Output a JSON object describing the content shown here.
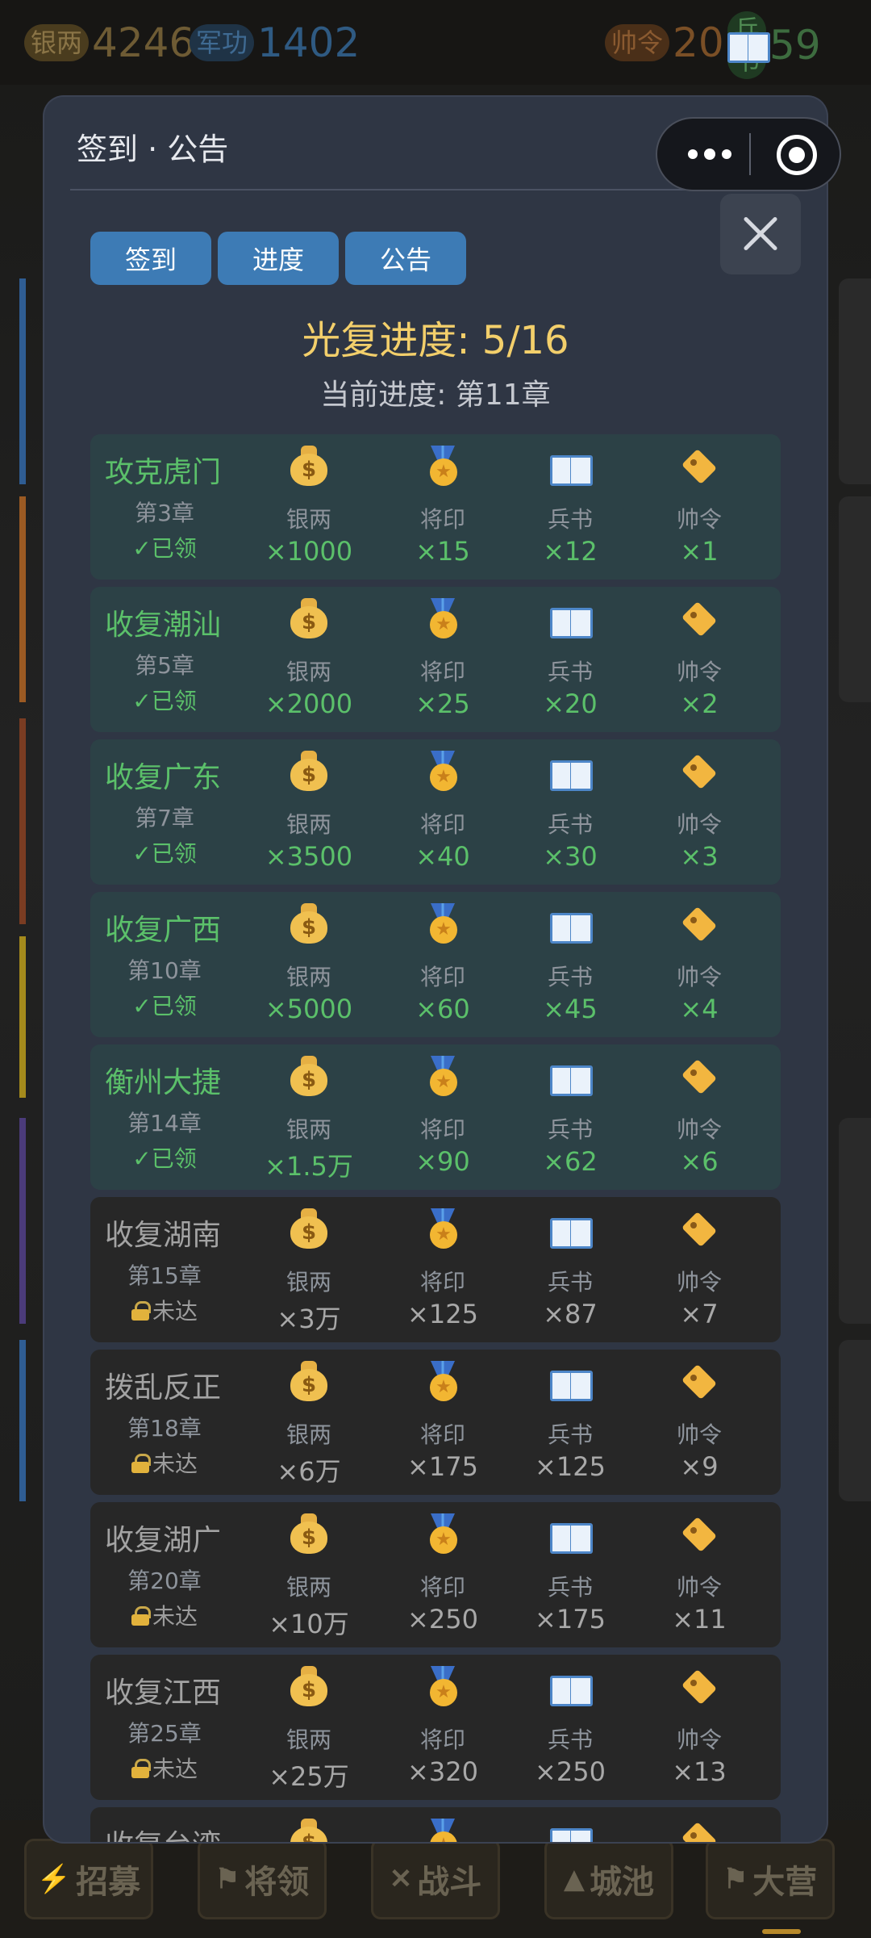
{
  "resources": {
    "silver": {
      "label": "银两",
      "value": "4246"
    },
    "merit": {
      "label": "军功",
      "value": "1402"
    },
    "order": {
      "label": "帅令",
      "value": "20"
    },
    "book": {
      "label": "兵书",
      "value": "59"
    }
  },
  "modal": {
    "title": "签到 · 公告",
    "tabs": [
      "签到",
      "进度",
      "公告"
    ],
    "progress_title": "光复进度: 5/16",
    "progress_sub": "当前进度: 第11章"
  },
  "reward_labels": [
    "银两",
    "将印",
    "兵书",
    "帅令"
  ],
  "cards": [
    {
      "state": "claimed",
      "name": "攻克虎门",
      "chapter": "第3章",
      "status": "✓已领",
      "values": [
        "×1000",
        "×15",
        "×12",
        "×1"
      ]
    },
    {
      "state": "claimed",
      "name": "收复潮汕",
      "chapter": "第5章",
      "status": "✓已领",
      "values": [
        "×2000",
        "×25",
        "×20",
        "×2"
      ]
    },
    {
      "state": "claimed",
      "name": "收复广东",
      "chapter": "第7章",
      "status": "✓已领",
      "values": [
        "×3500",
        "×40",
        "×30",
        "×3"
      ]
    },
    {
      "state": "claimed",
      "name": "收复广西",
      "chapter": "第10章",
      "status": "✓已领",
      "values": [
        "×5000",
        "×60",
        "×45",
        "×4"
      ]
    },
    {
      "state": "claimed",
      "name": "衡州大捷",
      "chapter": "第14章",
      "status": "✓已领",
      "values": [
        "×1.5万",
        "×90",
        "×62",
        "×6"
      ]
    },
    {
      "state": "locked",
      "name": "收复湖南",
      "chapter": "第15章",
      "status": "未达",
      "values": [
        "×3万",
        "×125",
        "×87",
        "×7"
      ]
    },
    {
      "state": "locked",
      "name": "拨乱反正",
      "chapter": "第18章",
      "status": "未达",
      "values": [
        "×6万",
        "×175",
        "×125",
        "×9"
      ]
    },
    {
      "state": "locked",
      "name": "收复湖广",
      "chapter": "第20章",
      "status": "未达",
      "values": [
        "×10万",
        "×250",
        "×175",
        "×11"
      ]
    },
    {
      "state": "locked",
      "name": "收复江西",
      "chapter": "第25章",
      "status": "未达",
      "values": [
        "×25万",
        "×320",
        "×250",
        "×13"
      ]
    },
    {
      "state": "locked",
      "name": "收复台湾",
      "chapter": "",
      "status": "",
      "values": [
        "",
        "",
        "",
        ""
      ]
    }
  ],
  "bottom_nav": [
    "招募",
    "将领",
    "战斗",
    "城池",
    "大营"
  ],
  "colors": {
    "accent": "#3d7bb5",
    "progress": "#f3cf6b",
    "claimed": "#5bc06a"
  }
}
